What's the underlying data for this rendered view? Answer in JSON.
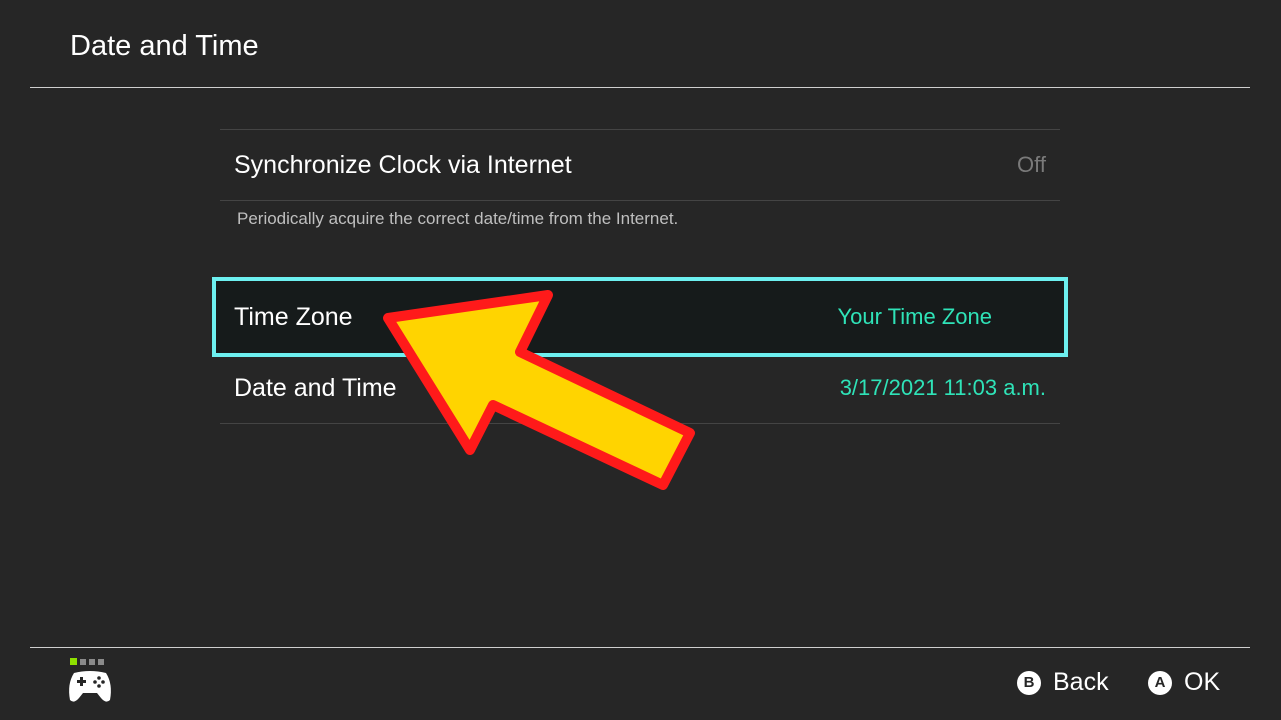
{
  "header": {
    "title": "Date and Time"
  },
  "settings": {
    "sync_clock": {
      "label": "Synchronize Clock via Internet",
      "value": "Off"
    },
    "sync_description": "Periodically acquire the correct date/time from the Internet.",
    "time_zone": {
      "label": "Time Zone",
      "value": "Your Time Zone"
    },
    "date_time": {
      "label": "Date and Time",
      "value": "3/17/2021 11:03 a.m."
    }
  },
  "footer": {
    "back": {
      "key": "B",
      "label": "Back"
    },
    "ok": {
      "key": "A",
      "label": "OK"
    }
  },
  "colors": {
    "background": "#262626",
    "selection_outline": "#6df0f0",
    "accent_value": "#2fe3b8",
    "arrow_fill": "#ffd400",
    "arrow_stroke": "#ff1a1a",
    "player_indicator_active": "#8ee000"
  },
  "icons": {
    "controller": "gamepad-icon",
    "callout": "arrow-pointer-annotation"
  }
}
